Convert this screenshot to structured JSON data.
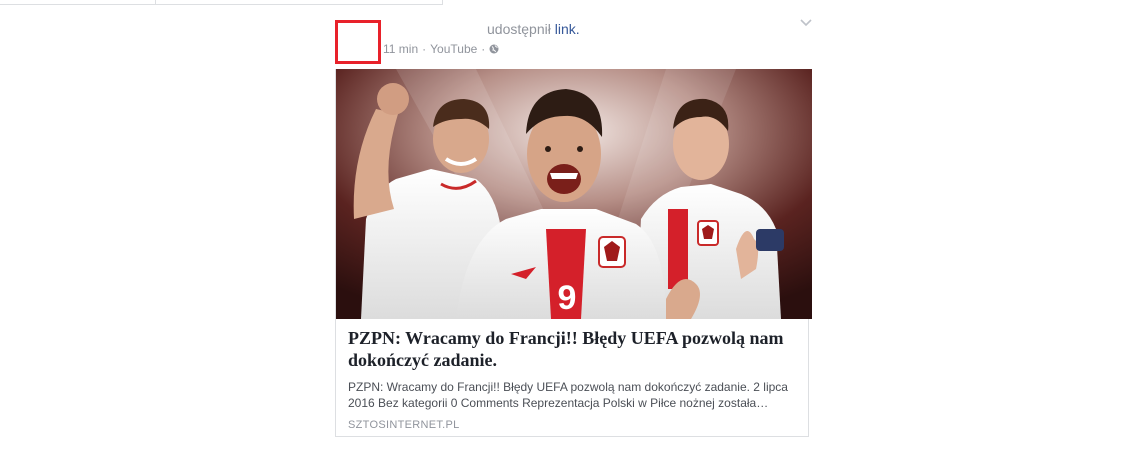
{
  "post": {
    "shared_text": "udostępnił",
    "link_text": "link.",
    "time": "11 min",
    "separator": "·",
    "source": "YouTube"
  },
  "card": {
    "title": "PZPN: Wracamy do Francji!! Błędy UEFA pozwolą nam dokończyć zadanie.",
    "description": "PZPN: Wracamy do Francji!! Błędy UEFA pozwolą nam dokończyć zadanie. 2 lipca 2016 Bez kategorii 0 Comments Reprezentacja Polski w Piłce nożnej została…",
    "domain": "SZTOSINTERNET.PL",
    "jersey_number": "9"
  },
  "icons": {
    "privacy": "globe-icon",
    "menu": "chevron-down-icon"
  },
  "colors": {
    "avatar_border": "#e8212a",
    "link": "#365899",
    "muted": "#90949c",
    "jersey_red": "#d4202a"
  }
}
